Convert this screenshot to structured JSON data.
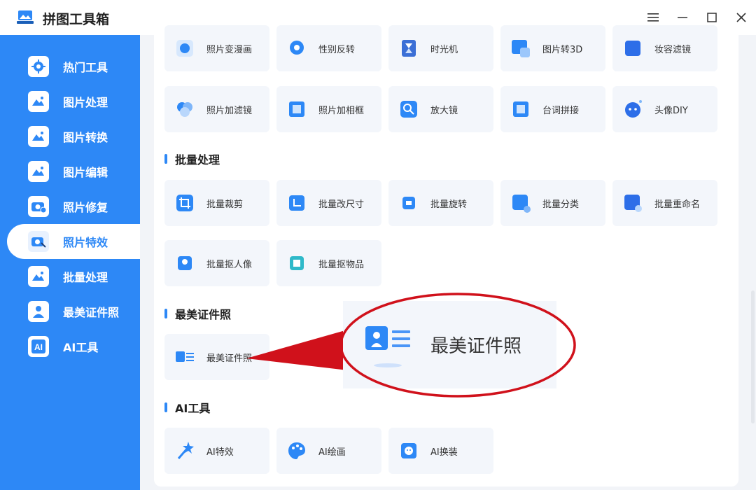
{
  "app": {
    "title": "拼图工具箱"
  },
  "window": {
    "menu_icon": "hamburger-icon",
    "min_icon": "minimize-icon",
    "max_icon": "maximize-icon",
    "close_icon": "close-icon"
  },
  "sidebar": {
    "active_index": 5,
    "items": [
      {
        "label": "热门工具",
        "icon": "gear-icon"
      },
      {
        "label": "图片处理",
        "icon": "image-clock-icon"
      },
      {
        "label": "图片转换",
        "icon": "image-convert-icon"
      },
      {
        "label": "图片编辑",
        "icon": "image-edit-icon"
      },
      {
        "label": "照片修复",
        "icon": "camera-plus-icon"
      },
      {
        "label": "照片特效",
        "icon": "camera-wand-icon"
      },
      {
        "label": "批量处理",
        "icon": "image-batch-icon"
      },
      {
        "label": "最美证件照",
        "icon": "id-person-icon"
      },
      {
        "label": "AI工具",
        "icon": "ai-icon"
      }
    ]
  },
  "sections": {
    "effects_row1": [
      "照片变漫画",
      "性别反转",
      "时光机",
      "图片转3D",
      "妆容滤镜"
    ],
    "effects_row2": [
      "照片加滤镜",
      "照片加相框",
      "放大镜",
      "台词拼接",
      "头像DIY"
    ],
    "batch": {
      "title": "批量处理",
      "items": [
        "批量裁剪",
        "批量改尺寸",
        "批量旋转",
        "批量分类",
        "批量重命名",
        "批量抠人像",
        "批量抠物品"
      ]
    },
    "idphoto": {
      "title": "最美证件照",
      "items": [
        "最美证件照"
      ]
    },
    "ai": {
      "title": "AI工具",
      "items": [
        "AI特效",
        "AI绘画",
        "AI换装"
      ]
    }
  },
  "callout": {
    "label": "最美证件照"
  },
  "colors": {
    "accent": "#2d88f6",
    "callout_red": "#d0111b"
  }
}
